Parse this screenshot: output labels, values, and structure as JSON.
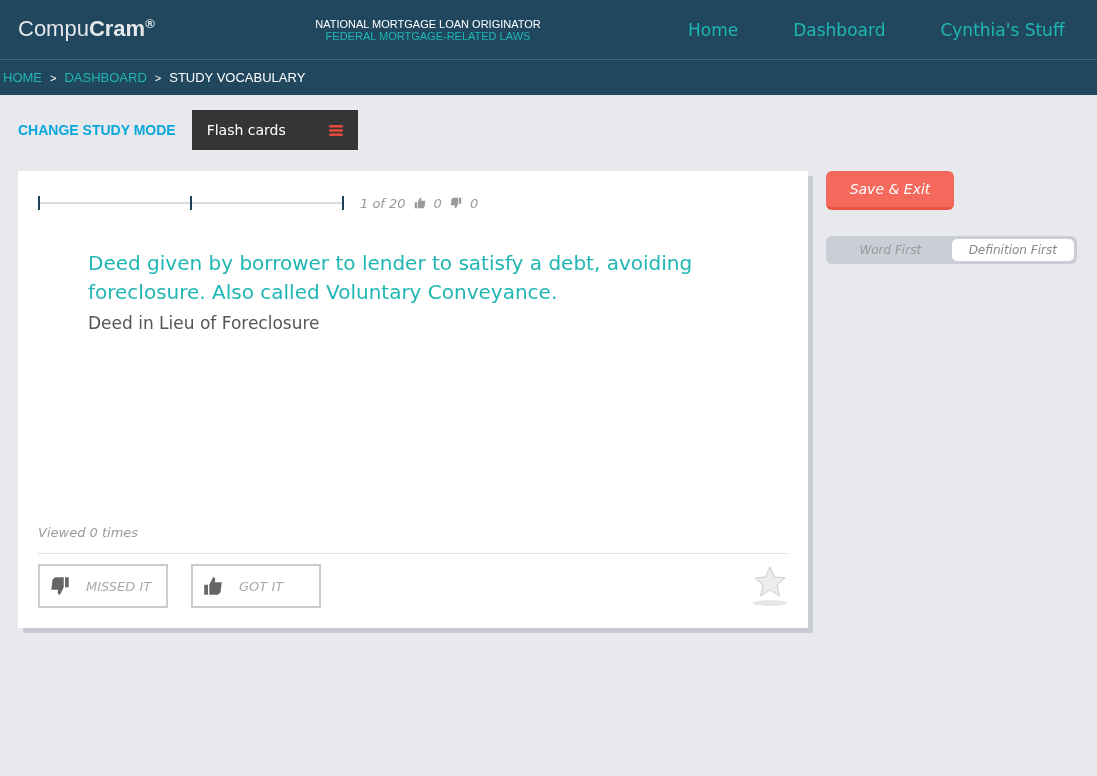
{
  "header": {
    "logo": "Compu**Cram**$^{®}$",
    "course_title": "NATIONAL MORTGAGE LOAN ORIGINATOR",
    "course_subtitle": "FEDERAL MORTGAGE-RELATED LAWS",
    "nav": [
      "Home",
      "Dashboard",
      "Cynthia's Stuff"
    ]
  },
  "breadcrumbs": [
    {
      "label": "HOME",
      "current": false
    },
    {
      "separator": ">",
      "label": "DASHBOARD",
      "current": false
    },
    {
      "separator": ">",
      "label": "STUDY VOCABULARY",
      "current": true
    }
  ],
  "study_mode": {
    "label": "CHANGE STUDY MODE",
    "value": "Flash cards"
  },
  "card": {
    "position": "1 of 20",
    "got_count": "0",
    "missed_count": "0",
    "definition": "Deed given by borrower to lender to satisfy a debt, avoiding foreclosure. Also called Voluntary Conveyance.",
    "term": "Deed in Lieu of Foreclosure",
    "viewed": "Viewed 0 times",
    "buttons": [
      {
        "kind": "missed",
        "label": "MISSED IT"
      },
      {
        "kind": "got",
        "label": "GOT IT"
      }
    ],
    "starred": false
  },
  "save_button": "Save & Exit",
  "order_toggle": [
    {
      "label": "Word First",
      "selected": false
    },
    {
      "label": "Definition First",
      "selected": true
    }
  ]
}
